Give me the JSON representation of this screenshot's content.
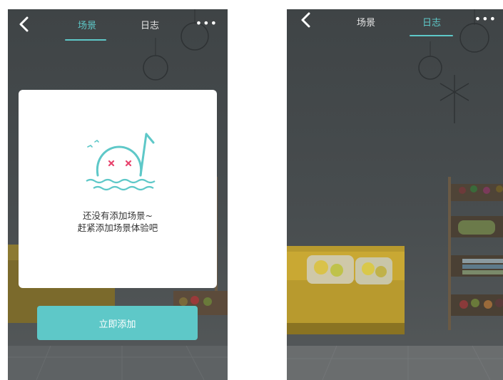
{
  "left_screen": {
    "tabs": [
      {
        "label": "场景",
        "active": true
      },
      {
        "label": "日志",
        "active": false
      }
    ],
    "menu_icon": "more-icon",
    "empty_state": {
      "line1": "还没有添加场景~",
      "line2": "赶紧添加场景体验吧"
    },
    "add_button_label": "立即添加"
  },
  "right_screen": {
    "tabs": [
      {
        "label": "场景",
        "active": false
      },
      {
        "label": "日志",
        "active": true
      }
    ],
    "menu_icon": "more-icon"
  },
  "colors": {
    "accent": "#5ec8c8",
    "mascot_eyes": "#e8456e",
    "sofa": "#b89a2e"
  }
}
